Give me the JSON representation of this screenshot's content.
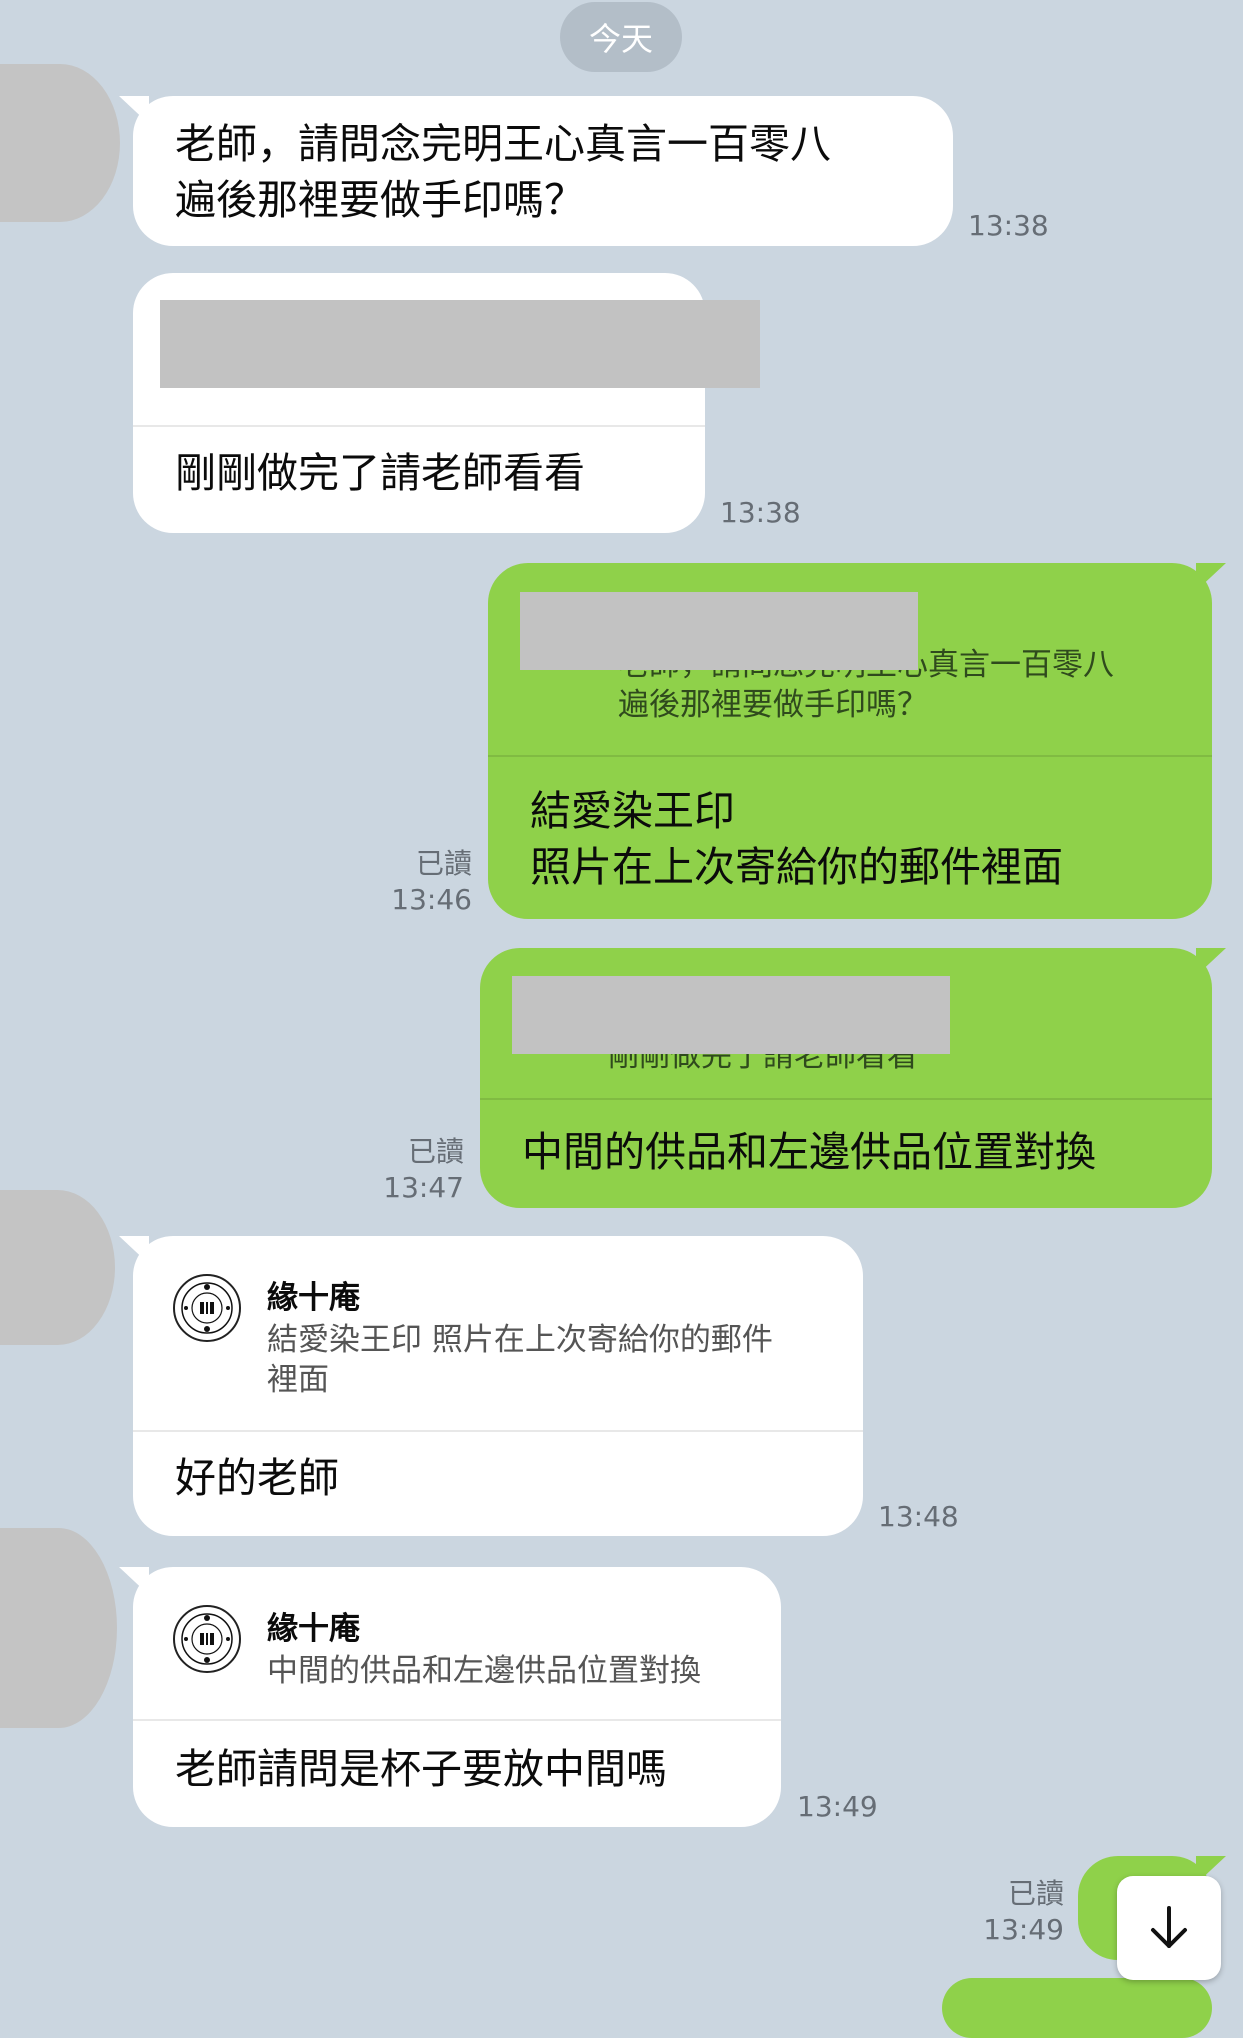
{
  "date_divider": "今天",
  "messages": [
    {
      "side": "incoming",
      "text": "老師，請問念完明王心真言一百零八\n遍後那裡要做手印嗎？",
      "time": "13:38"
    },
    {
      "side": "incoming",
      "quote_text": "",
      "text": "剛剛做完了請老師看看",
      "time": "13:38"
    },
    {
      "side": "outgoing",
      "quote_text": "老師，請問念完明王心真言一百零八\n遍後那裡要做手印嗎？",
      "text": "結愛染王印\n照片在上次寄給你的郵件裡面",
      "read": "已讀",
      "time": "13:46"
    },
    {
      "side": "outgoing",
      "quote_text": "剛剛做完了請老師看看",
      "text": "中間的供品和左邊供品位置對換",
      "read": "已讀",
      "time": "13:47"
    },
    {
      "side": "incoming",
      "quote_name": "緣十庵",
      "quote_text": "結愛染王印 照片在上次寄給你的郵件\n裡面",
      "text": "好的老師",
      "time": "13:48"
    },
    {
      "side": "incoming",
      "quote_name": "緣十庵",
      "quote_text": "中間的供品和左邊供品位置對換",
      "text": "老師請問是杯子要放中間嗎",
      "time": "13:49"
    },
    {
      "side": "outgoing",
      "read": "已讀",
      "time": "13:49"
    }
  ],
  "colors": {
    "background": "#cbd6e0",
    "outgoing_bubble": "#8fd14a",
    "incoming_bubble": "#ffffff"
  },
  "icons": {
    "scroll_down": "arrow-down-icon",
    "quote_avatar": "seal-stamp-icon"
  }
}
